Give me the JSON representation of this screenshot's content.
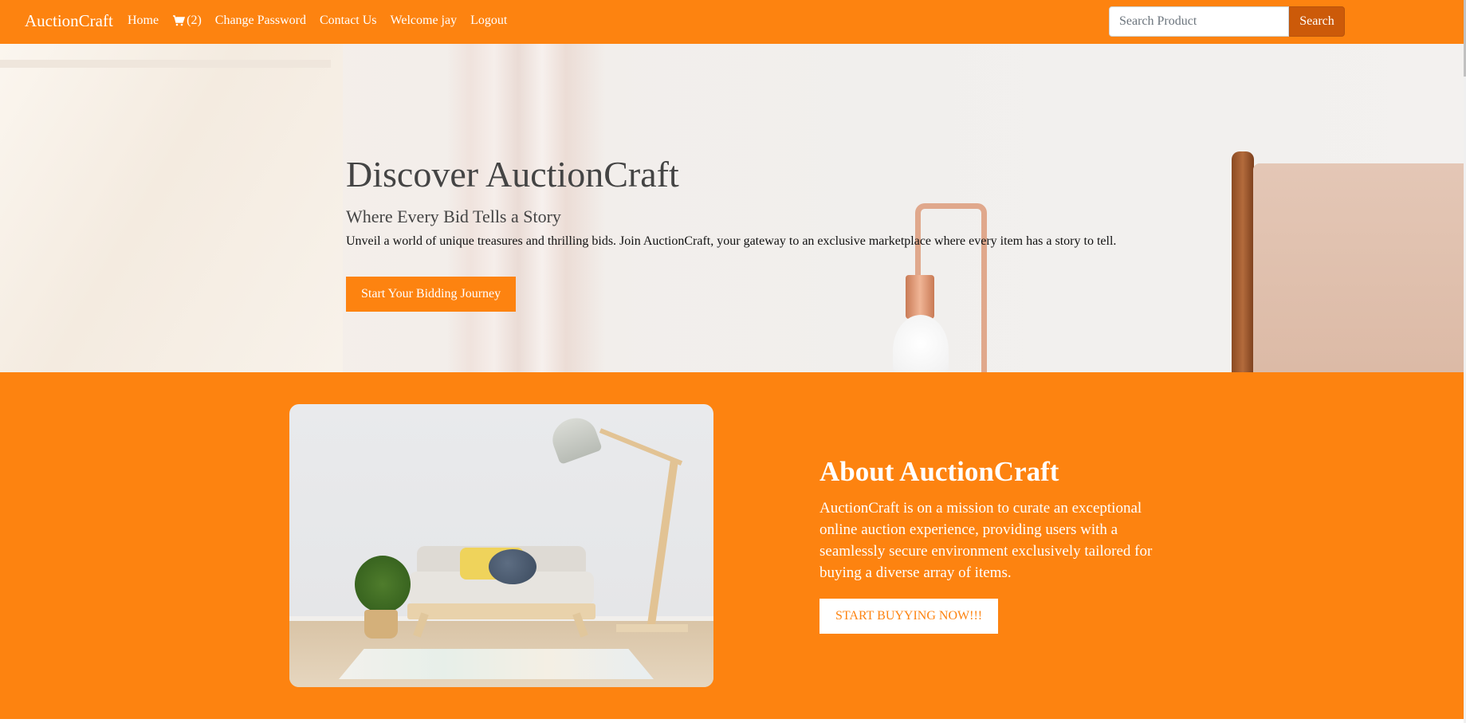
{
  "navbar": {
    "brand": "AuctionCraft",
    "links": {
      "home": "Home",
      "cart": "(2)",
      "change_password": "Change Password",
      "contact": "Contact Us",
      "welcome": "Welcome jay",
      "logout": "Logout"
    },
    "search": {
      "placeholder": "Search Product",
      "value": "",
      "button": "Search"
    }
  },
  "hero": {
    "title": "Discover AuctionCraft",
    "subtitle": "Where Every Bid Tells a Story",
    "text": "Unveil a world of unique treasures and thrilling bids. Join AuctionCraft, your gateway to an exclusive marketplace where every item has a story to tell.",
    "button": "Start Your Bidding Journey"
  },
  "about": {
    "title": "About AuctionCraft",
    "description": "AuctionCraft is on a mission to curate an exceptional online auction experience, providing users with a seamlessly secure environment exclusively tailored for buying a diverse array of items.",
    "button": "START BUYYING NOW!!!"
  },
  "colors": {
    "brand_orange": "#fd8310",
    "search_button": "#cc5a09"
  },
  "icons": {
    "cart": "shopping-cart-icon"
  }
}
